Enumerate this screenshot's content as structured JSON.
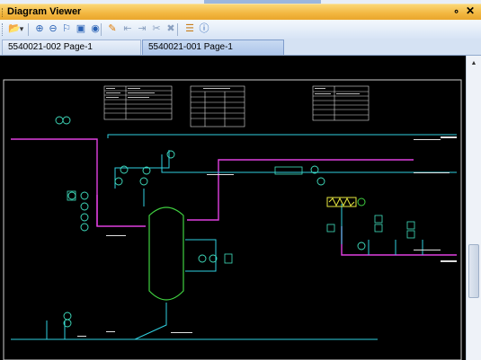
{
  "window": {
    "title": "Diagram Viewer",
    "pin_glyph": "∘",
    "close_glyph": "✕"
  },
  "toolbar": {
    "buttons": [
      {
        "icon": "open-folder-icon",
        "glyph": "📂",
        "color": "#e6a31e"
      },
      {
        "icon": "dropdown-arrow-icon",
        "glyph": "▾",
        "color": "#333333"
      },
      {
        "icon": "zoom-in-icon",
        "glyph": "⊕",
        "color": "#2a62b5"
      },
      {
        "icon": "zoom-out-icon",
        "glyph": "⊖",
        "color": "#2a62b5"
      },
      {
        "icon": "zoom-extents-icon",
        "glyph": "⚐",
        "color": "#2a62b5"
      },
      {
        "icon": "zoom-window-icon",
        "glyph": "▣",
        "color": "#2a62b5"
      },
      {
        "icon": "zoom-previous-icon",
        "glyph": "◉",
        "color": "#2a62b5"
      },
      {
        "icon": "highlight-icon",
        "glyph": "✎",
        "color": "#e07b00"
      },
      {
        "icon": "back-icon",
        "glyph": "⇤",
        "color": "#8aa0c0"
      },
      {
        "icon": "forward-icon",
        "glyph": "⇥",
        "color": "#8aa0c0"
      },
      {
        "icon": "cut-icon",
        "glyph": "✂",
        "color": "#8aa0c0"
      },
      {
        "icon": "delete-icon",
        "glyph": "✖",
        "color": "#8aa0c0"
      },
      {
        "icon": "properties-icon",
        "glyph": "☰",
        "color": "#c77d1a"
      },
      {
        "icon": "info-icon",
        "glyph": "ⓘ",
        "color": "#2a62b5"
      }
    ]
  },
  "tabs": [
    {
      "label": "5540021-002  Page-1",
      "active": false
    },
    {
      "label": "5540021-001  Page-1",
      "active": true
    }
  ],
  "scrollbar": {
    "up_glyph": "▲"
  }
}
